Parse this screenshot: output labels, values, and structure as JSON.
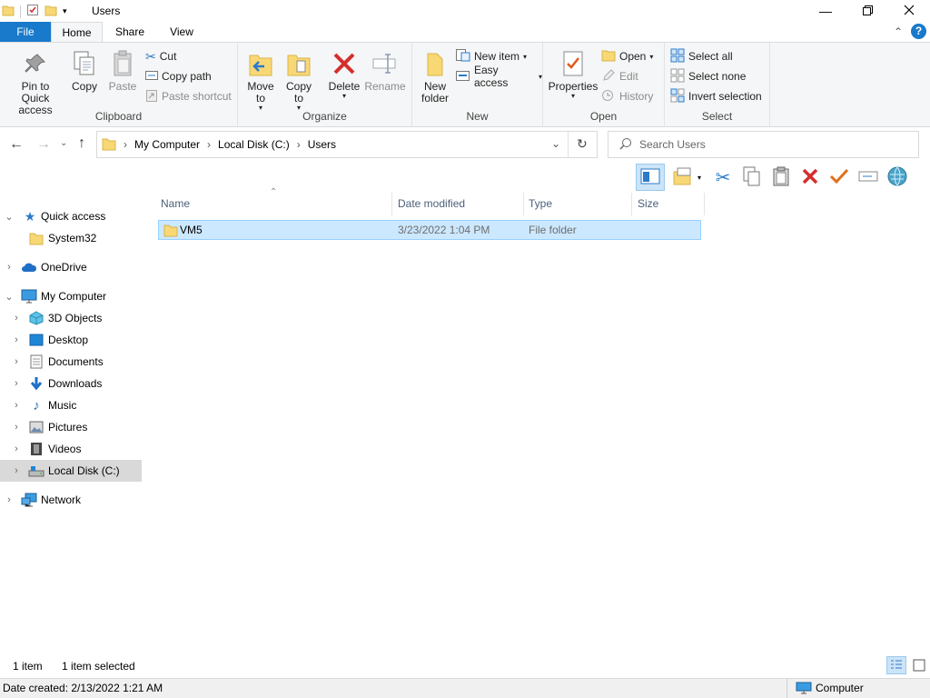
{
  "window": {
    "title": "Users"
  },
  "tabs": {
    "file": "File",
    "home": "Home",
    "share": "Share",
    "view": "View"
  },
  "ribbon": {
    "clipboard": {
      "label": "Clipboard",
      "pin": "Pin to Quick access",
      "copy": "Copy",
      "paste": "Paste",
      "cut": "Cut",
      "copy_path": "Copy path",
      "paste_shortcut": "Paste shortcut"
    },
    "organize": {
      "label": "Organize",
      "move_to": "Move to",
      "copy_to": "Copy to",
      "delete": "Delete",
      "rename": "Rename"
    },
    "new": {
      "label": "New",
      "new_folder_1": "New",
      "new_folder_2": "folder",
      "new_item": "New item",
      "easy_access": "Easy access"
    },
    "open": {
      "label": "Open",
      "properties": "Properties",
      "open": "Open",
      "edit": "Edit",
      "history": "History"
    },
    "select": {
      "label": "Select",
      "select_all": "Select all",
      "select_none": "Select none",
      "invert_selection": "Invert selection"
    }
  },
  "address": {
    "crumbs": [
      "My Computer",
      "Local Disk (C:)",
      "Users"
    ]
  },
  "search": {
    "placeholder": "Search Users"
  },
  "nav": {
    "quick_access": "Quick access",
    "system32": "System32",
    "onedrive": "OneDrive",
    "my_computer": "My Computer",
    "objects3d": "3D Objects",
    "desktop": "Desktop",
    "documents": "Documents",
    "downloads": "Downloads",
    "music": "Music",
    "pictures": "Pictures",
    "videos": "Videos",
    "local_disk": "Local Disk (C:)",
    "network": "Network"
  },
  "columns": {
    "name": "Name",
    "date_modified": "Date modified",
    "type": "Type",
    "size": "Size"
  },
  "files": [
    {
      "name": "VM5",
      "date_modified": "3/23/2022 1:04 PM",
      "type": "File folder",
      "size": ""
    }
  ],
  "status": {
    "count": "1 item",
    "selected": "1 item selected"
  },
  "bottom": {
    "date_created": "Date created: 2/13/2022 1:21 AM",
    "computer": "Computer"
  },
  "colors": {
    "accent": "#1979ca",
    "selection": "#cce8ff",
    "folder": "#f8d775"
  }
}
